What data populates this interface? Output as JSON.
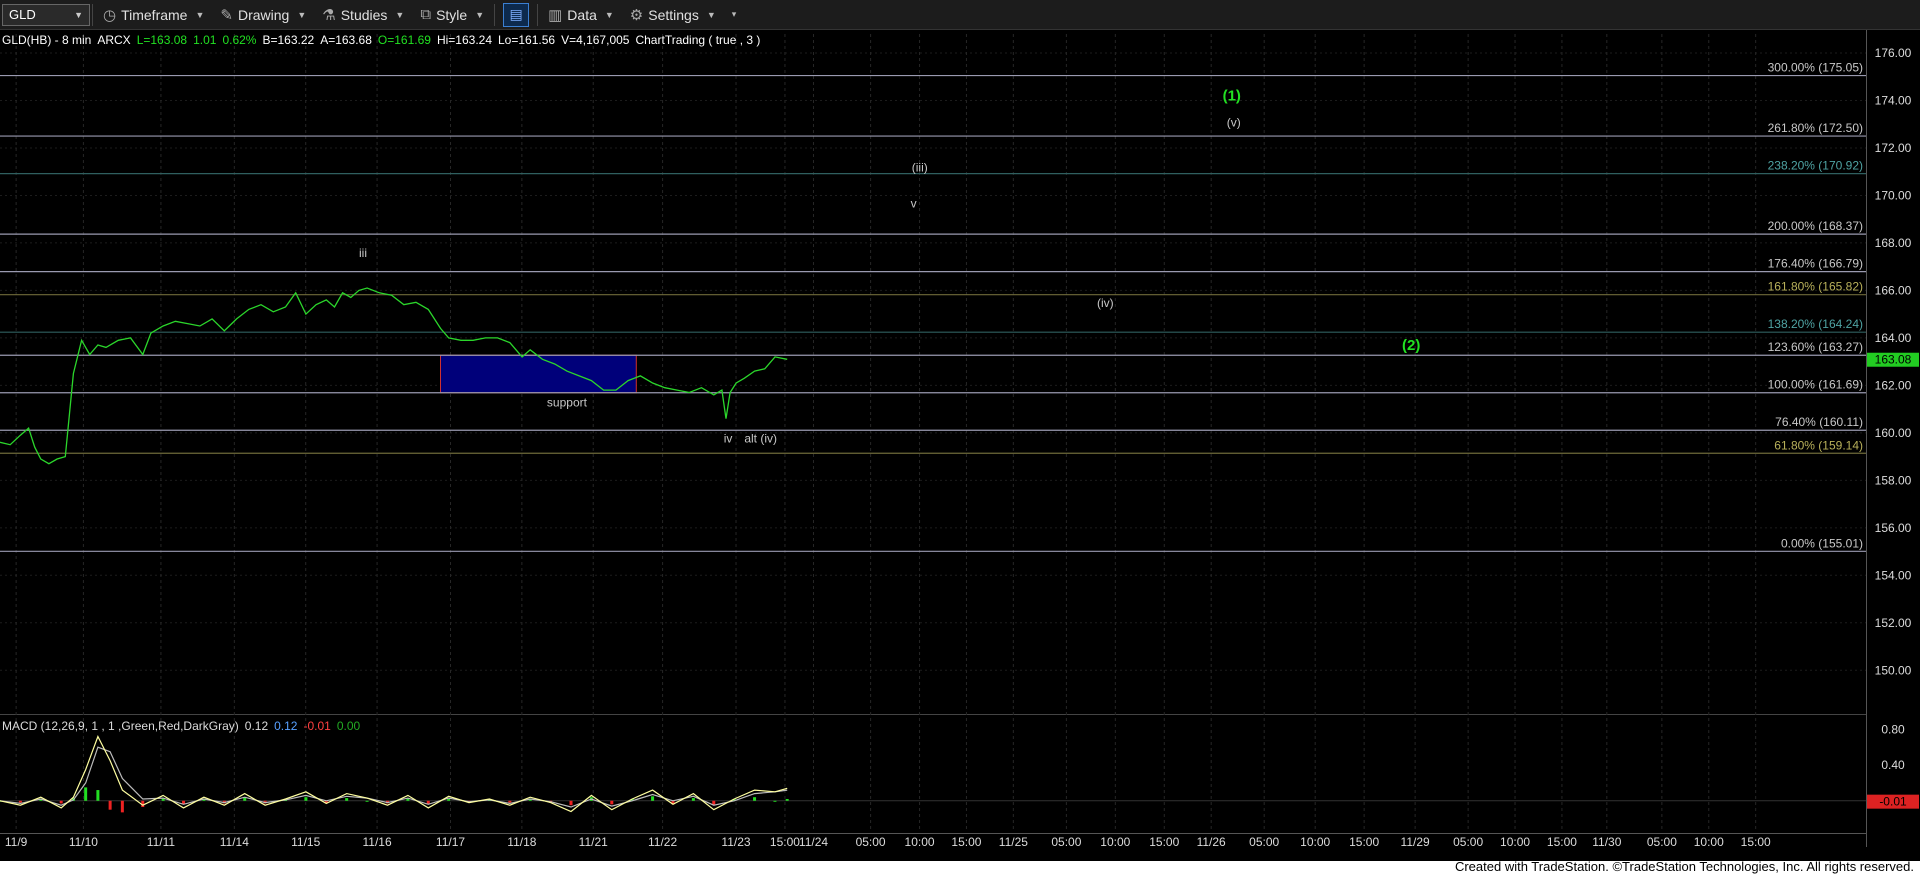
{
  "toolbar": {
    "symbol": "GLD",
    "timeframe_label": "Timeframe",
    "drawing_label": "Drawing",
    "studies_label": "Studies",
    "style_label": "Style",
    "data_label": "Data",
    "settings_label": "Settings"
  },
  "footer": {
    "credit": "Created with TradeStation. ©TradeStation Technologies, Inc. All rights reserved."
  },
  "colors": {
    "background": "#000000",
    "price_line": "#2bd62b",
    "fib_line": "#9a9ab0",
    "fib_label": "#c8c8c8",
    "fib_label_olive": "#b8b05a",
    "fib_label_teal": "#4fa3a3",
    "wave_label_green": "#22e022",
    "support_box": "#00007a",
    "support_border": "#d03030",
    "macd_line": "#ffffa0",
    "signal_line": "#bbbbbb",
    "hist_pos": "#22dd22",
    "hist_neg": "#ee2222",
    "last_price_bg": "#22cc22",
    "macd_last_bg": "#dd2222"
  },
  "chart_data": {
    "type": "line",
    "header": {
      "symbol": "GLD(HB) - 8 min",
      "exchange": "ARCX",
      "last": "L=163.08",
      "change": "1.01",
      "change_pct": "0.62%",
      "bid": "B=163.22",
      "ask": "A=163.68",
      "open": "O=161.69",
      "high": "Hi=163.24",
      "low": "Lo=161.56",
      "volume": "V=4,167,005",
      "study": "ChartTrading ( true , 3 )"
    },
    "x_ticks": [
      "11/9",
      "11/10",
      "11/11",
      "11/14",
      "11/15",
      "11/16",
      "11/17",
      "11/18",
      "11/21",
      "11/22",
      "11/23",
      "15:00",
      "11/24",
      "05:00",
      "10:00",
      "15:00",
      "11/25",
      "05:00",
      "10:00",
      "15:00",
      "11/26",
      "05:00",
      "10:00",
      "15:00",
      "11/29",
      "05:00",
      "10:00",
      "15:00",
      "11/30",
      "05:00",
      "10:00",
      "15:00"
    ],
    "x_tick_pos": [
      0.3,
      3.6,
      7.4,
      11.0,
      14.5,
      18.0,
      21.6,
      25.1,
      28.6,
      32.0,
      35.6,
      38.0,
      39.4,
      42.2,
      44.6,
      46.9,
      49.2,
      51.8,
      54.2,
      56.6,
      58.9,
      61.5,
      64.0,
      66.4,
      68.9,
      71.5,
      73.8,
      76.1,
      78.3,
      81.0,
      83.3,
      85.6
    ],
    "y_range": [
      148.2,
      176.8
    ],
    "y_ticks": [
      150.0,
      152.0,
      154.0,
      156.0,
      158.0,
      160.0,
      162.0,
      164.0,
      166.0,
      168.0,
      170.0,
      172.0,
      174.0,
      176.0
    ],
    "y_tick_labels": [
      "150.00",
      "152.00",
      "154.00",
      "156.00",
      "158.00",
      "160.00",
      "162.00",
      "164.00",
      "166.00",
      "168.00",
      "170.00",
      "172.00",
      "174.00",
      "176.00"
    ],
    "last_price_label": "163.08",
    "last_price": 163.08,
    "fib_levels": [
      {
        "label": "300.00% (175.05)",
        "value": 175.05,
        "tone": "white"
      },
      {
        "label": "261.80% (172.50)",
        "value": 172.5,
        "tone": "white"
      },
      {
        "label": "238.20% (170.92)",
        "value": 170.92,
        "tone": "teal"
      },
      {
        "label": "200.00% (168.37)",
        "value": 168.37,
        "tone": "white"
      },
      {
        "label": "176.40% (166.79)",
        "value": 166.79,
        "tone": "white"
      },
      {
        "label": "161.80% (165.82)",
        "value": 165.82,
        "tone": "olive"
      },
      {
        "label": "138.20% (164.24)",
        "value": 164.24,
        "tone": "teal"
      },
      {
        "label": "123.60% (163.27)",
        "value": 163.27,
        "tone": "white"
      },
      {
        "label": "100.00% (161.69)",
        "value": 161.69,
        "tone": "white"
      },
      {
        "label": "76.40% (160.11)",
        "value": 160.11,
        "tone": "white"
      },
      {
        "label": "61.80% (159.14)",
        "value": 159.14,
        "tone": "olive"
      },
      {
        "label": "0.00% (155.01)",
        "value": 155.01,
        "tone": "white"
      }
    ],
    "support_zone": {
      "x_from": 21.6,
      "x_to": 31.2,
      "y_from": 161.69,
      "y_to": 163.27,
      "label": "support",
      "label_x": 27.8,
      "label_y": 161.1
    },
    "annotations": [
      {
        "text": "iii",
        "x": 17.8,
        "y": 167.4,
        "color": "white"
      },
      {
        "text": "iv",
        "x": 35.7,
        "y": 159.6,
        "color": "white"
      },
      {
        "text": "alt (iv)",
        "x": 37.3,
        "y": 159.6,
        "color": "white"
      },
      {
        "text": "(iii)",
        "x": 45.1,
        "y": 171.0,
        "color": "white"
      },
      {
        "text": "v",
        "x": 44.8,
        "y": 169.5,
        "color": "white"
      },
      {
        "text": "(iv)",
        "x": 54.2,
        "y": 165.3,
        "color": "white"
      },
      {
        "text": "(1)",
        "x": 60.4,
        "y": 174.0,
        "color": "green"
      },
      {
        "text": "(v)",
        "x": 60.5,
        "y": 172.9,
        "color": "white"
      },
      {
        "text": "(2)",
        "x": 69.2,
        "y": 163.5,
        "color": "green"
      }
    ],
    "price_series": {
      "name": "GLD",
      "x": [
        0,
        0.5,
        1.0,
        1.4,
        1.7,
        2.0,
        2.4,
        2.8,
        3.2,
        3.6,
        4.0,
        4.4,
        4.8,
        5.2,
        5.8,
        6.4,
        7.0,
        7.4,
        8.0,
        8.6,
        9.2,
        9.8,
        10.4,
        11.0,
        11.6,
        12.2,
        12.8,
        13.4,
        14.0,
        14.5,
        15.0,
        15.5,
        16.0,
        16.4,
        16.8,
        17.2,
        17.6,
        18.0,
        18.6,
        19.2,
        19.8,
        20.4,
        21.0,
        21.6,
        22.0,
        22.6,
        23.2,
        23.8,
        24.4,
        25.0,
        25.6,
        26.0,
        26.6,
        27.2,
        27.8,
        28.4,
        29.0,
        29.6,
        30.2,
        30.8,
        31.4,
        32.0,
        32.6,
        33.2,
        33.8,
        34.4,
        35.0,
        35.4,
        35.6,
        35.8,
        36.1,
        36.5,
        37.0,
        37.5,
        38.0,
        38.6
      ],
      "y": [
        159.6,
        159.5,
        159.9,
        160.2,
        159.4,
        158.9,
        158.7,
        158.9,
        159.0,
        162.5,
        163.9,
        163.3,
        163.7,
        163.6,
        163.9,
        164.0,
        163.3,
        164.2,
        164.5,
        164.7,
        164.6,
        164.5,
        164.8,
        164.3,
        164.8,
        165.2,
        165.4,
        165.1,
        165.3,
        165.9,
        165.0,
        165.4,
        165.6,
        165.3,
        165.9,
        165.7,
        166.0,
        166.1,
        165.9,
        165.8,
        165.4,
        165.5,
        165.2,
        164.4,
        164.0,
        163.9,
        163.9,
        164.0,
        164.0,
        163.8,
        163.2,
        163.5,
        163.1,
        162.9,
        162.6,
        162.4,
        162.2,
        161.8,
        161.8,
        162.2,
        162.4,
        162.1,
        161.9,
        161.8,
        161.7,
        161.9,
        161.6,
        161.8,
        160.6,
        161.7,
        162.1,
        162.3,
        162.6,
        162.7,
        163.2,
        163.1
      ]
    },
    "macd": {
      "label": "MACD (12,26,9, 1 , 1 ,Green,Red,DarkGray)",
      "value1": "0.12",
      "value2": "0.12",
      "value3": "-0.01",
      "value4": "0.00",
      "y_range": [
        -0.35,
        0.95
      ],
      "y_ticks": [
        0.4,
        0.8
      ],
      "y_tick_labels": [
        "0.40",
        "0.80"
      ],
      "last_label": "-0.01",
      "last_value": -0.01,
      "x": [
        0,
        1,
        2,
        3,
        3.6,
        4.2,
        4.8,
        5.4,
        6,
        7,
        8,
        9,
        10,
        11,
        12,
        13,
        14,
        15,
        16,
        17,
        18,
        19,
        20,
        21,
        22,
        23,
        24,
        25,
        26,
        27,
        28,
        29,
        30,
        31,
        32,
        33,
        34,
        35,
        36,
        37,
        38,
        38.6
      ],
      "macd_line": [
        0.0,
        -0.05,
        0.04,
        -0.08,
        0.04,
        0.35,
        0.72,
        0.45,
        0.12,
        -0.05,
        0.06,
        -0.08,
        0.04,
        -0.05,
        0.08,
        -0.05,
        0.02,
        0.1,
        -0.03,
        0.08,
        0.03,
        -0.05,
        0.06,
        -0.08,
        0.05,
        -0.02,
        0.02,
        -0.05,
        0.04,
        -0.02,
        -0.12,
        0.06,
        -0.1,
        0.02,
        0.12,
        -0.04,
        0.08,
        -0.1,
        0.02,
        0.12,
        0.1,
        0.14
      ],
      "signal_line": [
        0.0,
        -0.03,
        0.02,
        -0.05,
        0.01,
        0.2,
        0.6,
        0.55,
        0.25,
        0.02,
        0.03,
        -0.04,
        0.02,
        -0.02,
        0.04,
        -0.02,
        0.01,
        0.06,
        0.0,
        0.05,
        0.03,
        -0.02,
        0.03,
        -0.04,
        0.03,
        -0.01,
        0.01,
        -0.03,
        0.02,
        -0.01,
        -0.07,
        0.02,
        -0.06,
        0.0,
        0.07,
        0.0,
        0.05,
        -0.05,
        0.0,
        0.08,
        0.1,
        0.12
      ],
      "histogram": [
        0.0,
        -0.02,
        0.02,
        -0.03,
        0.03,
        0.15,
        0.12,
        -0.1,
        -0.13,
        -0.07,
        0.03,
        -0.04,
        0.02,
        -0.03,
        0.04,
        -0.03,
        0.01,
        0.04,
        -0.03,
        0.03,
        0.0,
        -0.03,
        0.03,
        -0.04,
        0.02,
        -0.01,
        0.01,
        -0.02,
        0.02,
        -0.01,
        -0.05,
        0.04,
        -0.04,
        0.02,
        0.05,
        -0.04,
        0.03,
        -0.05,
        0.02,
        0.04,
        0.0,
        0.02
      ]
    }
  }
}
